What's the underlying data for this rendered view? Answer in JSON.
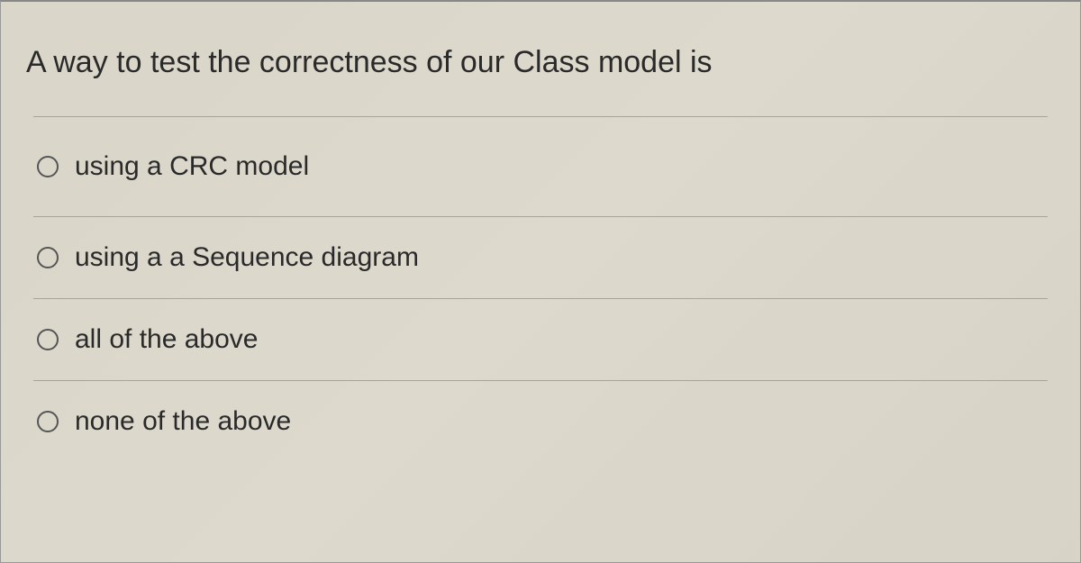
{
  "question": {
    "text": "A way to test the correctness of our Class model is",
    "options": [
      {
        "label": "using a CRC model"
      },
      {
        "label": "using a a Sequence diagram"
      },
      {
        "label": "all of the above"
      },
      {
        "label": "none of the above"
      }
    ]
  }
}
